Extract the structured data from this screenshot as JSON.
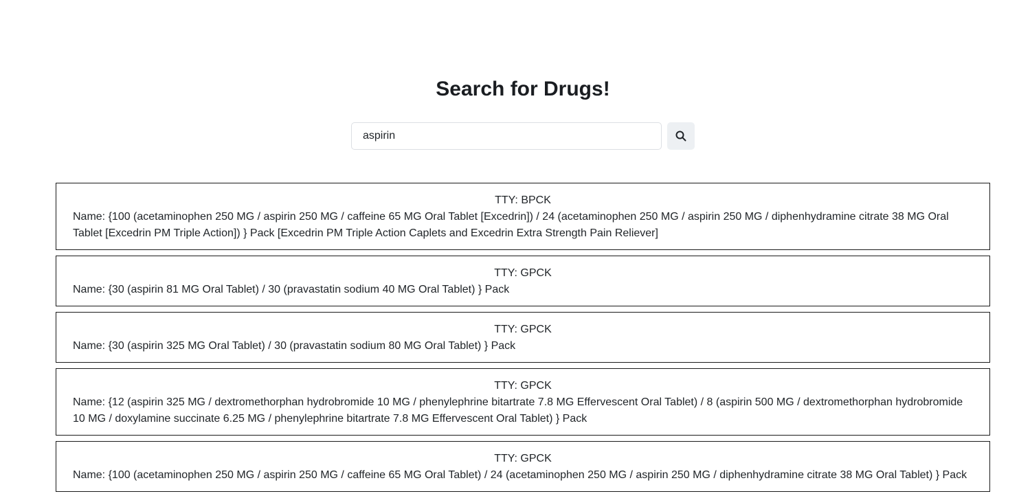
{
  "page": {
    "title": "Search for Drugs!"
  },
  "search": {
    "value": "aspirin",
    "button_icon": "search-icon"
  },
  "results": [
    {
      "tty": "TTY: BPCK",
      "name": "Name: {100 (acetaminophen 250 MG / aspirin 250 MG / caffeine 65 MG Oral Tablet [Excedrin]) / 24 (acetaminophen 250 MG / aspirin 250 MG / diphenhydramine citrate 38 MG Oral Tablet [Excedrin PM Triple Action]) } Pack [Excedrin PM Triple Action Caplets and Excedrin Extra Strength Pain Reliever]"
    },
    {
      "tty": "TTY: GPCK",
      "name": "Name: {30 (aspirin 81 MG Oral Tablet) / 30 (pravastatin sodium 40 MG Oral Tablet) } Pack"
    },
    {
      "tty": "TTY: GPCK",
      "name": "Name: {30 (aspirin 325 MG Oral Tablet) / 30 (pravastatin sodium 80 MG Oral Tablet) } Pack"
    },
    {
      "tty": "TTY: GPCK",
      "name": "Name: {12 (aspirin 325 MG / dextromethorphan hydrobromide 10 MG / phenylephrine bitartrate 7.8 MG Effervescent Oral Tablet) / 8 (aspirin 500 MG / dextromethorphan hydrobromide 10 MG / doxylamine succinate 6.25 MG / phenylephrine bitartrate 7.8 MG Effervescent Oral Tablet) } Pack"
    },
    {
      "tty": "TTY: GPCK",
      "name": "Name: {100 (acetaminophen 250 MG / aspirin 250 MG / caffeine 65 MG Oral Tablet) / 24 (acetaminophen 250 MG / aspirin 250 MG / diphenhydramine citrate 38 MG Oral Tablet) } Pack"
    }
  ]
}
